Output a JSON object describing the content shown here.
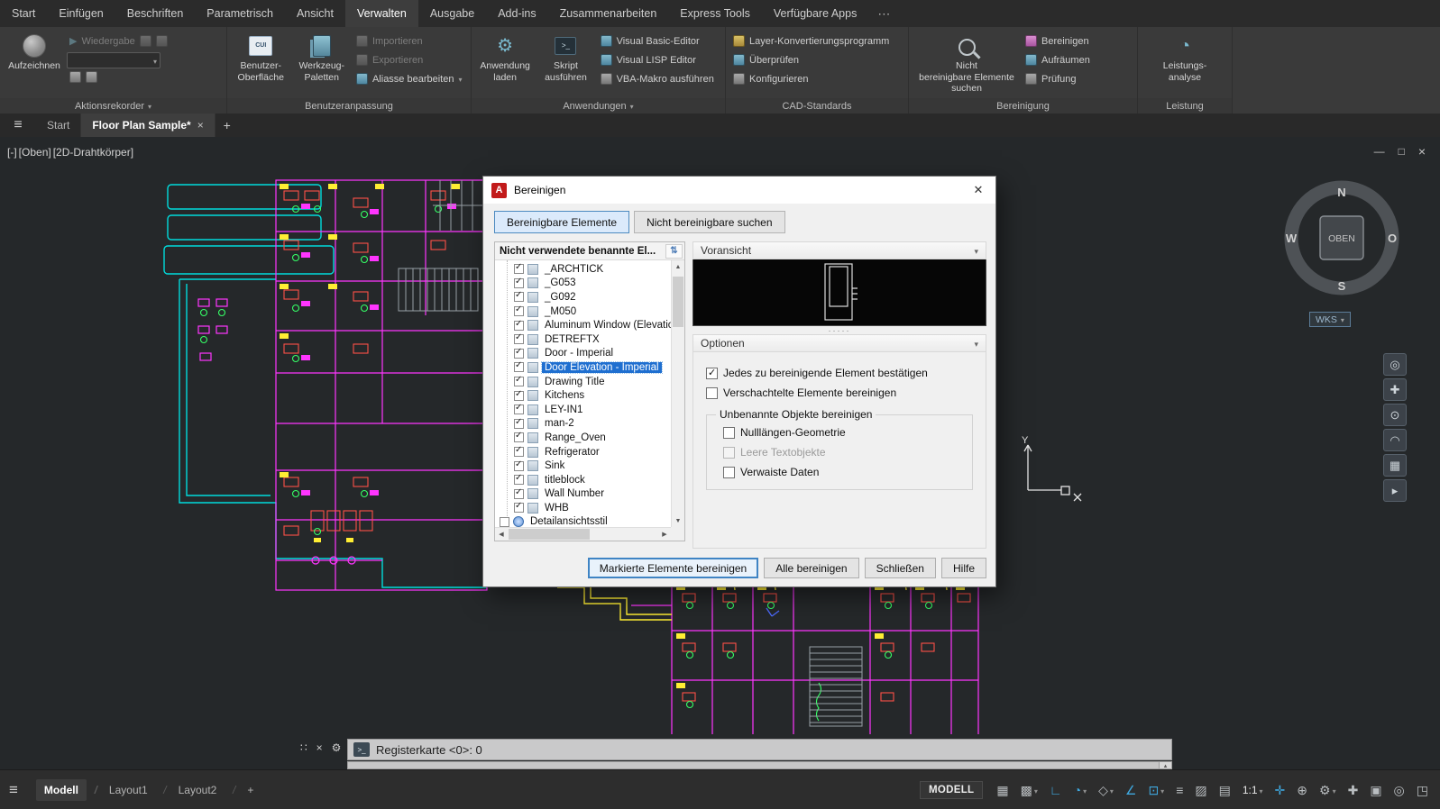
{
  "menubar": {
    "tabs": [
      {
        "label": "Start",
        "name": "ribbon-tab-start"
      },
      {
        "label": "Einfügen",
        "name": "ribbon-tab-einfuegen"
      },
      {
        "label": "Beschriften",
        "name": "ribbon-tab-beschriften"
      },
      {
        "label": "Parametrisch",
        "name": "ribbon-tab-parametrisch"
      },
      {
        "label": "Ansicht",
        "name": "ribbon-tab-ansicht"
      },
      {
        "label": "Verwalten",
        "name": "ribbon-tab-verwalten",
        "active": true
      },
      {
        "label": "Ausgabe",
        "name": "ribbon-tab-ausgabe"
      },
      {
        "label": "Add-ins",
        "name": "ribbon-tab-addins"
      },
      {
        "label": "Zusammenarbeiten",
        "name": "ribbon-tab-zusammenarbeiten"
      },
      {
        "label": "Express Tools",
        "name": "ribbon-tab-express-tools"
      },
      {
        "label": "Verfügbare Apps",
        "name": "ribbon-tab-verfuegbare-apps"
      }
    ],
    "overflow_icon": "⋯"
  },
  "ribbon": {
    "aktionsrekorder": {
      "label": "Aktionsrekorder",
      "record": "Aufzeichnen",
      "play": "Wiedergabe"
    },
    "benutzeranpassung": {
      "label": "Benutzeranpassung",
      "cui_l1": "Benutzer-",
      "cui_l2": "Oberfläche",
      "cui_icon_text": "CUI",
      "tp_l1": "Werkzeug-",
      "tp_l2": "Paletten",
      "small": [
        {
          "label": "Importieren",
          "name": "import-button",
          "icon": "import-icon",
          "disabled": true,
          "gray": true
        },
        {
          "label": "Exportieren",
          "name": "export-button",
          "icon": "export-icon",
          "disabled": true,
          "gray": true
        },
        {
          "label": "Aliasse bearbeiten",
          "name": "edit-aliases-button",
          "icon": "edit-aliases-icon",
          "dropdown": true
        }
      ]
    },
    "anwendungen": {
      "label": "Anwendungen",
      "load_l1": "Anwendung",
      "load_l2": "laden",
      "script_l1": "Skript",
      "script_l2": "ausführen",
      "small": [
        {
          "label": "Visual Basic-Editor",
          "name": "visual-basic-editor-button",
          "icon": "vb-editor-icon"
        },
        {
          "label": "Visual LISP Editor",
          "name": "visual-lisp-editor-button",
          "icon": "lisp-editor-icon"
        },
        {
          "label": "VBA-Makro ausführen",
          "name": "vba-macro-button",
          "icon": "vba-macro-icon",
          "gray": true
        }
      ]
    },
    "cad_standards": {
      "label": "CAD-Standards",
      "small": [
        {
          "label": "Layer-Konvertierungsprogramm",
          "name": "layer-translator-button",
          "icon": "layer-translator-icon",
          "yellow": true
        },
        {
          "label": "Überprüfen",
          "name": "check-standards-button",
          "icon": "check-standards-icon"
        },
        {
          "label": "Konfigurieren",
          "name": "configure-standards-button",
          "icon": "configure-standards-icon",
          "gray": true
        }
      ]
    },
    "bereinigung": {
      "label": "Bereinigung",
      "big_l1": "Nicht",
      "big_l2": "bereinigbare Elemente suchen",
      "small": [
        {
          "label": "Bereinigen",
          "name": "purge-button",
          "icon": "purge-icon",
          "pink": true
        },
        {
          "label": "Aufräumen",
          "name": "overkill-button",
          "icon": "overkill-icon"
        },
        {
          "label": "Prüfung",
          "name": "audit-button",
          "icon": "audit-icon",
          "gray": true
        }
      ]
    },
    "leistung": {
      "label": "Leistung",
      "big_l1": "Leistungs-",
      "big_l2": "analyse"
    }
  },
  "filetabs": {
    "tabs": [
      {
        "label": "Start",
        "name": "file-tab-start"
      },
      {
        "label": "Floor Plan Sample*",
        "name": "file-tab-floor-plan-sample",
        "active": true,
        "closable": true
      }
    ],
    "new_tab_icon": "+"
  },
  "viewport": {
    "controls": [
      {
        "label": "[-]",
        "name": "viewport-menu-control"
      },
      {
        "label": "[Oben]",
        "name": "view-control"
      },
      {
        "label": "[2D-Drahtkörper]",
        "name": "visual-style-control"
      }
    ]
  },
  "viewcube": {
    "north": "N",
    "south": "S",
    "west": "W",
    "east": "O",
    "top_face": "OBEN",
    "wcs_label": "WKS"
  },
  "ucs": {
    "y_label": "Y"
  },
  "navbar": {
    "icons": [
      {
        "name": "navigation-wheel-icon",
        "glyph": "◎"
      },
      {
        "name": "pan-icon",
        "glyph": "✚"
      },
      {
        "name": "zoom-icon",
        "glyph": "⊙"
      },
      {
        "name": "orbit-icon",
        "glyph": "◠"
      },
      {
        "name": "viewcube-settings-icon",
        "glyph": "▦"
      },
      {
        "name": "showmotion-icon",
        "glyph": "▸"
      }
    ]
  },
  "dialog": {
    "logo_text": "A",
    "title": "Bereinigen",
    "tabs": [
      {
        "label": "Bereinigbare Elemente",
        "name": "tab-purgeable-items",
        "active": true
      },
      {
        "label": "Nicht bereinigbare suchen",
        "name": "tab-find-non-purgeable"
      }
    ],
    "tree_header": "Nicht verwendete benannte El...",
    "tree_items": [
      {
        "label": "_ARCHTICK",
        "checked": true
      },
      {
        "label": "_G053",
        "checked": true
      },
      {
        "label": "_G092",
        "checked": true
      },
      {
        "label": "_M050",
        "checked": true
      },
      {
        "label": "Aluminum Window (Elevation",
        "checked": true
      },
      {
        "label": "DETREFTX",
        "checked": true
      },
      {
        "label": "Door - Imperial",
        "checked": true
      },
      {
        "label": "Door Elevation - Imperial",
        "checked": true,
        "selected": true
      },
      {
        "label": "Drawing Title",
        "checked": true
      },
      {
        "label": "Kitchens",
        "checked": true
      },
      {
        "label": "LEY-IN1",
        "checked": true
      },
      {
        "label": "man-2",
        "checked": true
      },
      {
        "label": "Range_Oven",
        "checked": true
      },
      {
        "label": "Refrigerator",
        "checked": true
      },
      {
        "label": "Sink",
        "checked": true
      },
      {
        "label": "titleblock",
        "checked": true
      },
      {
        "label": "Wall Number",
        "checked": true
      },
      {
        "label": "WHB",
        "checked": true
      },
      {
        "label": "Detailansichtsstil",
        "checked": false,
        "root": true
      }
    ],
    "preview_header": "Voransicht",
    "options_header": "Optionen",
    "options": [
      {
        "label": "Jedes zu bereinigende Element bestätigen",
        "checked": true
      },
      {
        "label": "Verschachtelte Elemente bereinigen",
        "checked": false
      }
    ],
    "group_label": "Unbenannte Objekte bereinigen",
    "group_options": [
      {
        "label": "Nulllängen-Geometrie",
        "checked": false
      },
      {
        "label": "Leere Textobjekte",
        "checked": false,
        "disabled": true
      },
      {
        "label": "Verwaiste Daten",
        "checked": false
      }
    ],
    "buttons": [
      {
        "label": "Markierte Elemente bereinigen",
        "name": "purge-checked-items-button",
        "default": true
      },
      {
        "label": "Alle bereinigen",
        "name": "purge-all-button"
      },
      {
        "label": "Schließen",
        "name": "close-button"
      },
      {
        "label": "Hilfe",
        "name": "help-button"
      }
    ]
  },
  "commandline": {
    "prompt_text": "Registerkarte <0>: 0"
  },
  "statusbar": {
    "model_button": "MODELL",
    "layout_tabs": [
      {
        "label": "Modell",
        "name": "layout-tab-modell",
        "active": true
      },
      {
        "label": "Layout1",
        "name": "layout-tab-layout1"
      },
      {
        "label": "Layout2",
        "name": "layout-tab-layout2"
      },
      {
        "label": "+",
        "name": "new-layout-button",
        "new": true
      }
    ],
    "right_icons": [
      {
        "name": "grid-icon",
        "glyph": "▦"
      },
      {
        "name": "snap-icon",
        "glyph": "▩",
        "dropdown": true
      },
      {
        "name": "ortho-icon",
        "glyph": "∟",
        "active": true
      },
      {
        "name": "polar-tracking-icon",
        "glyph": "◔",
        "dropdown": true,
        "active": true
      },
      {
        "name": "isodraft-icon",
        "glyph": "◇",
        "dropdown": true
      },
      {
        "name": "osnap-tracking-icon",
        "glyph": "∠",
        "active": true
      },
      {
        "name": "osnap-icon",
        "glyph": "⊡",
        "dropdown": true,
        "active": true
      },
      {
        "name": "lineweight-icon",
        "glyph": "≡"
      },
      {
        "name": "transparency-icon",
        "glyph": "▨"
      },
      {
        "name": "selection-cycling-icon",
        "glyph": "▤"
      },
      {
        "name": "annotation-scale-label",
        "glyph": "1:1",
        "dropdown": true,
        "text": true
      },
      {
        "name": "annotation-visibility-icon",
        "glyph": "✛",
        "active": true
      },
      {
        "name": "autoscale-icon",
        "glyph": "⊕"
      },
      {
        "name": "workspace-gear-icon",
        "glyph": "⚙",
        "dropdown": true
      },
      {
        "name": "annotation-monitor-icon",
        "glyph": "✚"
      },
      {
        "name": "hardware-acceleration-icon",
        "glyph": "▣"
      },
      {
        "name": "isolate-objects-icon",
        "glyph": "◎"
      },
      {
        "name": "clean-screen-icon",
        "glyph": "◳"
      }
    ]
  }
}
